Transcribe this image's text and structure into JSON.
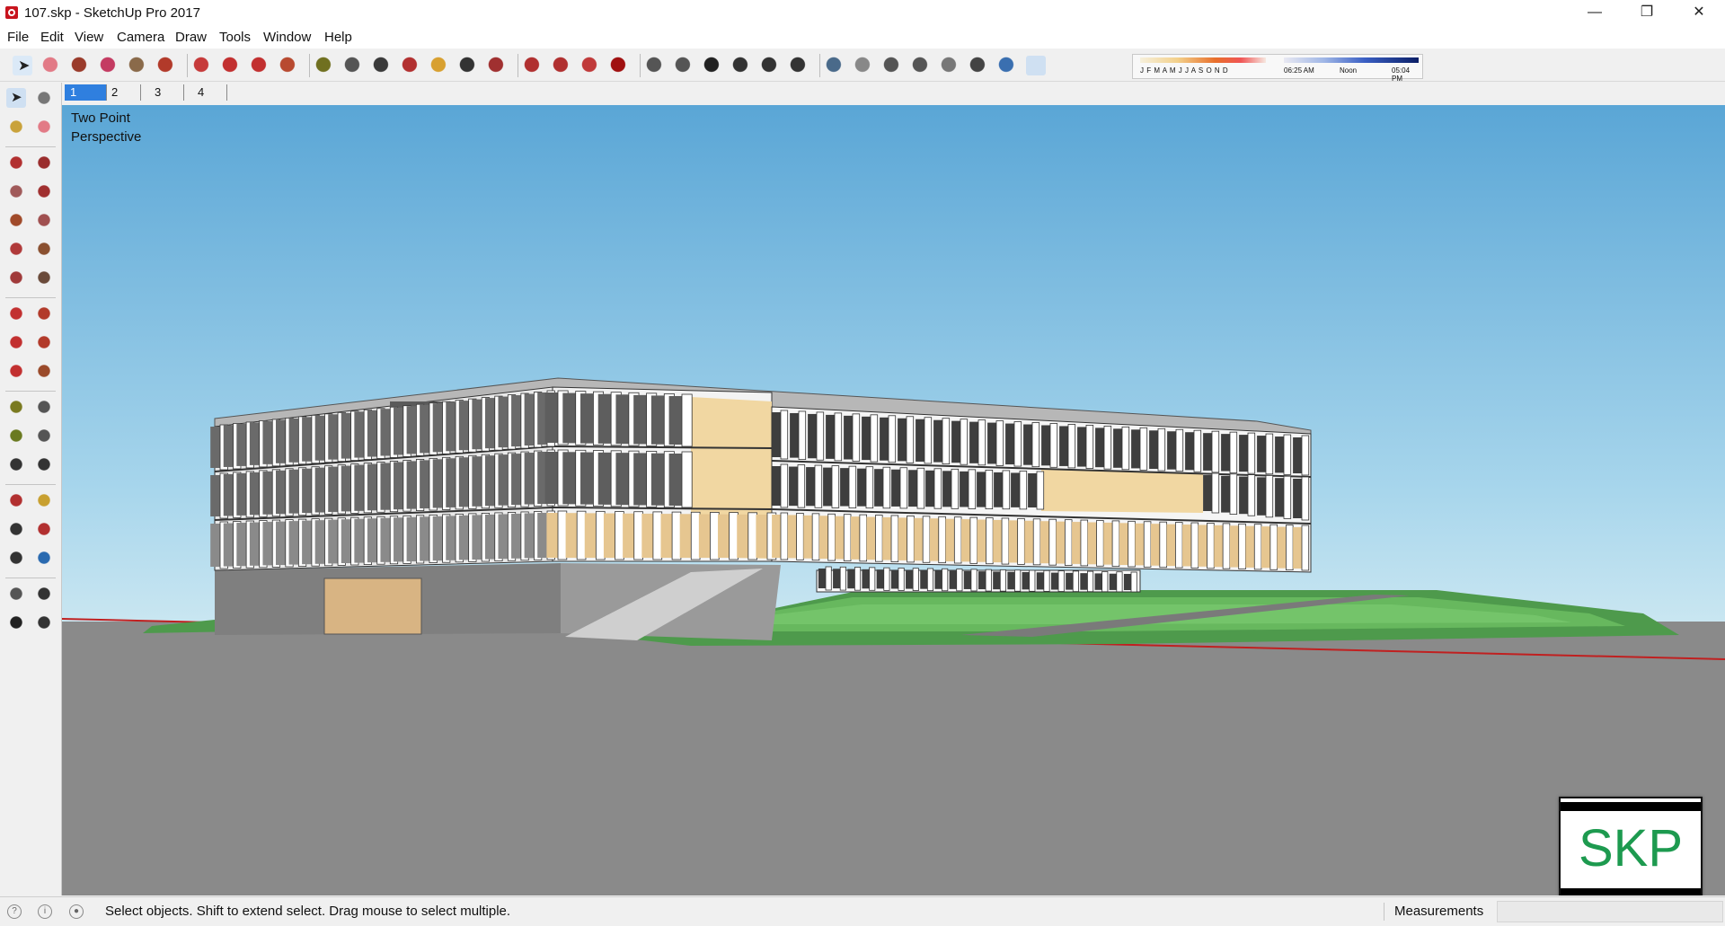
{
  "window": {
    "title": "107.skp - SketchUp Pro 2017",
    "minimize": "—",
    "maximize": "❐",
    "close": "✕"
  },
  "menu": [
    "File",
    "Edit",
    "View",
    "Camera",
    "Draw",
    "Tools",
    "Window",
    "Help"
  ],
  "shadow": {
    "months": "J F M A M J J A S O N D",
    "time_start": "06:25 AM",
    "time_mid": "Noon",
    "time_end": "05:04 PM"
  },
  "scenes": [
    {
      "label": "1",
      "active": true
    },
    {
      "label": "2",
      "active": false
    },
    {
      "label": "3",
      "active": false
    },
    {
      "label": "4",
      "active": false
    }
  ],
  "viewport": {
    "camera_label": "Two Point Perspective"
  },
  "watermark": {
    "text": "SKP"
  },
  "status": {
    "message": "Select objects. Shift to extend select. Drag mouse to select multiple.",
    "measurements_label": "Measurements",
    "measurements_value": ""
  },
  "colors": {
    "sky_top": "#5aa6d6",
    "sky_bottom": "#bfe0ef",
    "ground": "#8a8a8a",
    "lawn": "#5fae5a",
    "accent_tab": "#2f7fdf"
  },
  "toolbar_icons": [
    "select-icon",
    "eraser-icon",
    "line-icon",
    "arc-icon",
    "shape-icon",
    "push-pull-icon",
    "follow-me-icon",
    "move-icon",
    "rotate-icon",
    "scale-icon",
    "tape-measure-icon",
    "text-icon",
    "paint-bucket-icon",
    "orbit-icon",
    "pan-icon",
    "zoom-icon",
    "zoom-extents-icon",
    "3d-warehouse-icon",
    "extension-warehouse-icon",
    "send-to-layout-icon",
    "ruby-icon",
    "iso-view-icon",
    "top-view-icon",
    "front-view-icon",
    "right-view-icon",
    "back-view-icon",
    "left-view-icon",
    "xray-icon",
    "back-edges-icon",
    "wireframe-icon",
    "hidden-line-icon",
    "shaded-icon",
    "shaded-textures-icon",
    "monochrome-icon",
    "shadows-toggle-icon"
  ],
  "left_icons": [
    [
      "select-icon",
      "component-icon"
    ],
    [
      "paint-bucket-icon",
      "eraser-icon"
    ],
    [
      "line-icon",
      "freehand-icon"
    ],
    [
      "rectangle-icon",
      "rotated-rectangle-icon"
    ],
    [
      "circle-icon",
      "polygon-icon"
    ],
    [
      "arc-icon",
      "two-point-arc-icon"
    ],
    [
      "three-point-arc-icon",
      "pie-icon"
    ],
    [
      "move-icon",
      "push-pull-icon"
    ],
    [
      "rotate-icon",
      "follow-me-icon"
    ],
    [
      "scale-icon",
      "offset-icon"
    ],
    [
      "tape-measure-icon",
      "dimension-icon"
    ],
    [
      "protractor-icon",
      "text-icon"
    ],
    [
      "axes-icon",
      "3d-text-icon"
    ],
    [
      "orbit-icon",
      "pan-icon"
    ],
    [
      "zoom-icon",
      "zoom-window-icon"
    ],
    [
      "zoom-extents-icon",
      "previous-view-icon"
    ],
    [
      "position-camera-icon",
      "look-around-icon"
    ],
    [
      "walk-icon",
      "section-plane-icon"
    ]
  ]
}
